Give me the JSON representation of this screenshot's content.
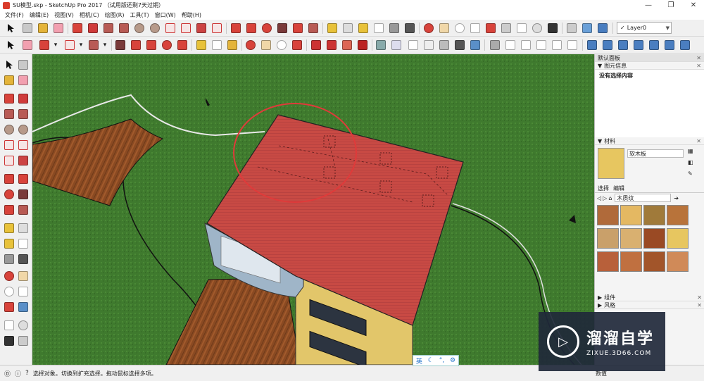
{
  "window": {
    "title": "SU模型.skp - SketchUp Pro 2017 （试用版还剩7天过期）"
  },
  "menu": [
    "文件(F)",
    "编辑(E)",
    "视图(V)",
    "相机(C)",
    "绘图(R)",
    "工具(T)",
    "窗口(W)",
    "帮助(H)"
  ],
  "toolbar": {
    "layer_value": "Layer0"
  },
  "panel": {
    "tray_title": "默认面板",
    "entity_info": {
      "header": "图元信息",
      "text": "没有选择内容"
    },
    "materials": {
      "header": "材料",
      "current_name": "软木板",
      "tab_select": "选择",
      "tab_edit": "编辑",
      "library_value": "木质纹"
    },
    "collapsed": [
      "组件",
      "风格"
    ],
    "bottom_label": "数值"
  },
  "status": {
    "text": "选择对象。切换到扩充选择。拖动鼠标选择多项。"
  },
  "ime": {
    "lang": "英"
  },
  "watermark": {
    "name": "溜溜自学",
    "url": "ZIXUE.3D66.COM"
  },
  "colors": {
    "grass": "#3f7a2e",
    "roof": "#c84a44",
    "wall": "#e2c66a",
    "path_wood": "#8a4a22"
  }
}
